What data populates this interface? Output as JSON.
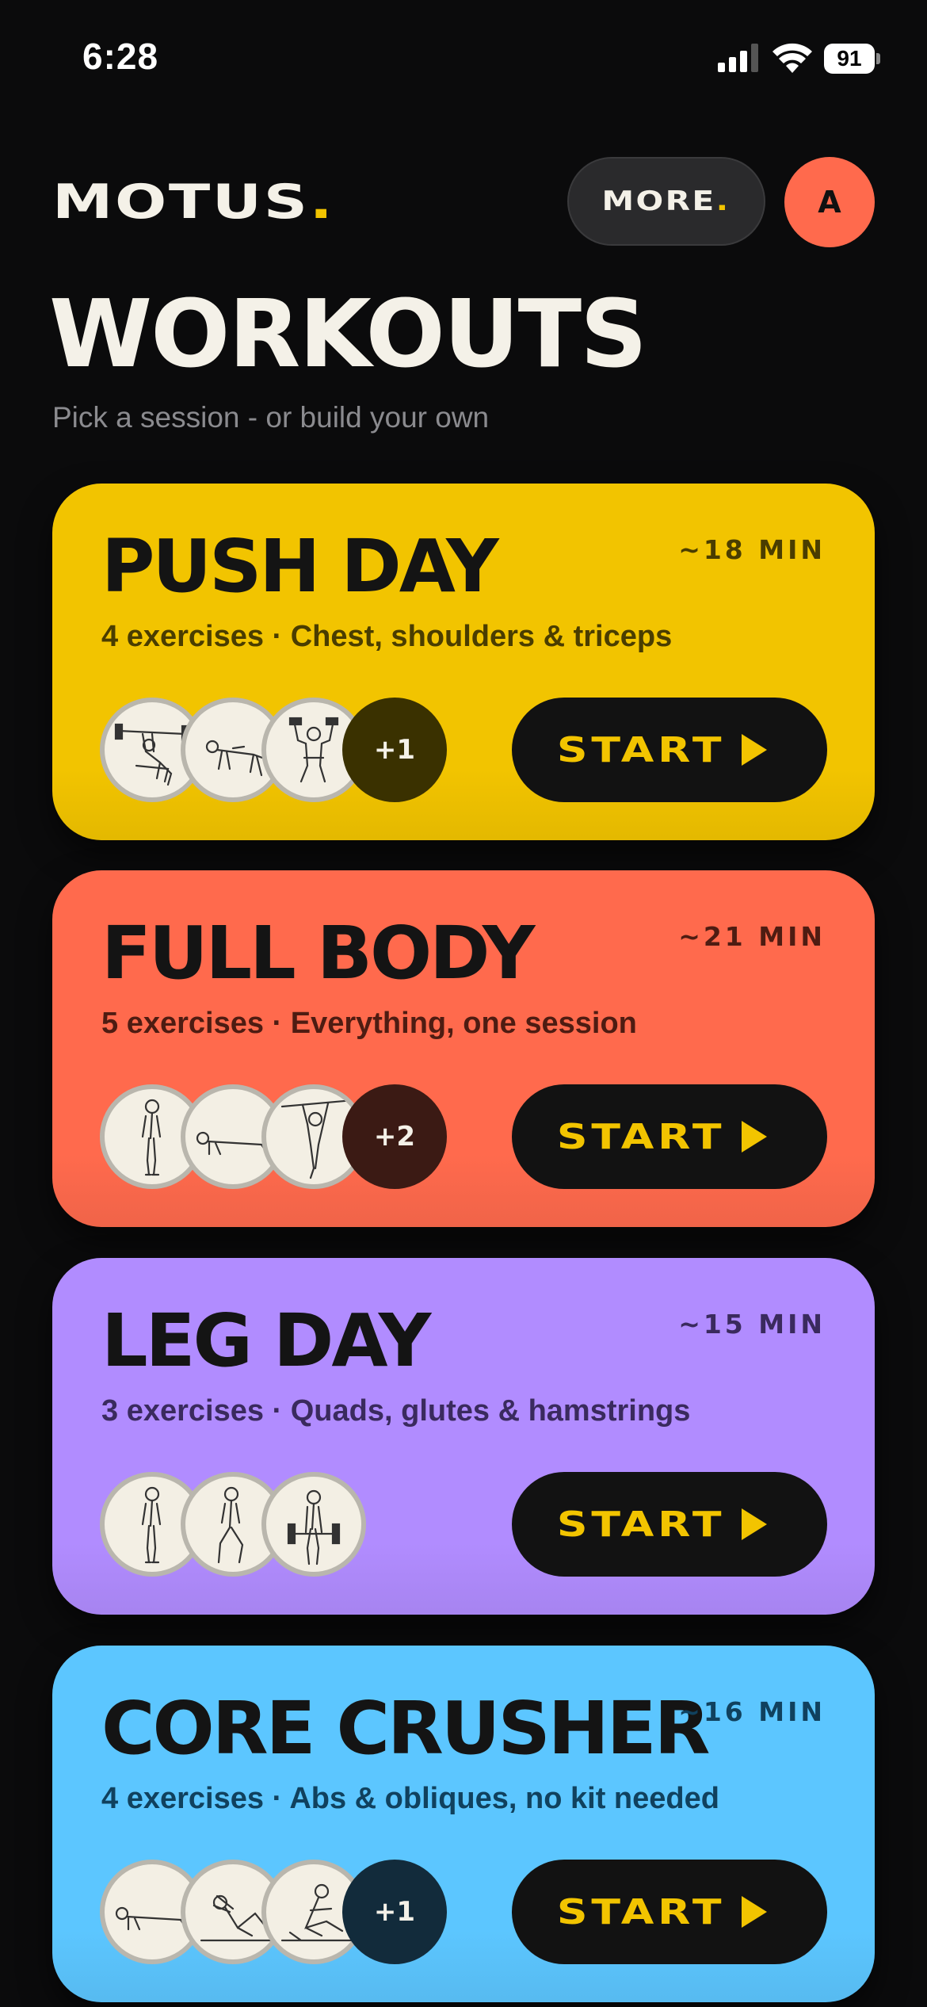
{
  "status_bar": {
    "time": "6:28",
    "battery": "91"
  },
  "header": {
    "logo": "MOTUS",
    "logo_dot": ".",
    "more_label": "MORE",
    "more_dot": ".",
    "avatar_initial": "A"
  },
  "page": {
    "title": "WORKOUTS",
    "subtitle": "Pick a session - or build your own"
  },
  "start_label": "START",
  "workouts": [
    {
      "name": "PUSH DAY",
      "duration": "~18 MIN",
      "description": "4 exercises · Chest, shoulders & triceps",
      "extra_count": "+1",
      "color": "#f2c400",
      "text_color": "#4a3d00",
      "badge_color": "#3a3100",
      "exercises": [
        "bench-press",
        "push-up",
        "shoulder-press"
      ]
    },
    {
      "name": "FULL BODY",
      "duration": "~21 MIN",
      "description": "5 exercises · Everything, one session",
      "extra_count": "+2",
      "color": "#ff6a4d",
      "text_color": "#4e1c12",
      "badge_color": "#3b1a14",
      "exercises": [
        "squat",
        "plank",
        "pull-up"
      ]
    },
    {
      "name": "LEG DAY",
      "duration": "~15 MIN",
      "description": "3 exercises · Quads, glutes & hamstrings",
      "extra_count": "",
      "color": "#b18cff",
      "text_color": "#3a2a5e",
      "badge_color": "#2d2140",
      "exercises": [
        "squat",
        "lunge",
        "deadlift"
      ]
    },
    {
      "name": "CORE CRUSHER",
      "duration": "~16 MIN",
      "description": "4 exercises · Abs & obliques, no kit needed",
      "extra_count": "+1",
      "color": "#5cc6ff",
      "text_color": "#10415e",
      "badge_color": "#122b3b",
      "exercises": [
        "plank",
        "crunch",
        "russian-twist"
      ]
    }
  ]
}
